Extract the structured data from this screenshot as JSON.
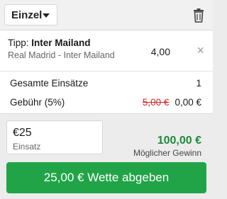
{
  "header": {
    "bet_type": "Einzel"
  },
  "bet": {
    "tip_prefix": "Tipp:",
    "tip_selection": "Inter Mailand",
    "match": "Real Madrid - Inter Mailand",
    "odds": "4,00",
    "remove_symbol": "×"
  },
  "summary": {
    "total_stakes_label": "Gesamte Einsätze",
    "total_stakes_value": "1",
    "fee_label": "Gebühr (5%)",
    "fee_old": "5,00 €",
    "fee_new": "0,00 €"
  },
  "stake": {
    "value": "€25",
    "label": "Einsatz"
  },
  "win": {
    "value": "100,00 €",
    "label": "Möglicher Gewinn"
  },
  "action": {
    "place_bet_label": "25,00 € Wette abgeben"
  },
  "icons": {
    "dropdown": "chevron-down-icon",
    "delete": "trash-icon",
    "remove": "close-icon"
  },
  "colors": {
    "accent_green": "#21a447",
    "win_green": "#1f8a3b",
    "strike_red": "#d12b2b"
  }
}
